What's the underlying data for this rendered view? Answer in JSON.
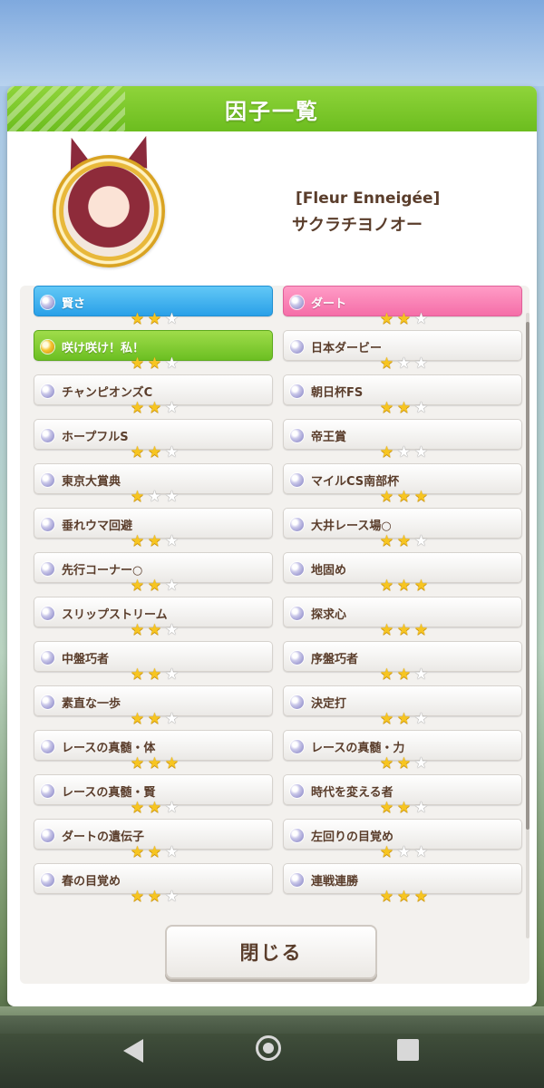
{
  "header": {
    "title": "因子一覧"
  },
  "character": {
    "title": "[Fleur Enneigée]",
    "name": "サクラチヨノオー"
  },
  "factors": {
    "left": [
      {
        "name": "賢さ",
        "stars": 2,
        "type": "blue"
      },
      {
        "name": "咲け咲け！私！",
        "stars": 2,
        "type": "green"
      },
      {
        "name": "チャンピオンズC",
        "stars": 2,
        "type": "normal"
      },
      {
        "name": "ホープフルS",
        "stars": 2,
        "type": "normal"
      },
      {
        "name": "東京大賞典",
        "stars": 1,
        "type": "normal"
      },
      {
        "name": "垂れウマ回避",
        "stars": 2,
        "type": "normal"
      },
      {
        "name": "先行コーナー○",
        "stars": 2,
        "type": "normal"
      },
      {
        "name": "スリップストリーム",
        "stars": 2,
        "type": "normal"
      },
      {
        "name": "中盤巧者",
        "stars": 2,
        "type": "normal"
      },
      {
        "name": "素直な一歩",
        "stars": 2,
        "type": "normal"
      },
      {
        "name": "レースの真髄・体",
        "stars": 3,
        "type": "normal"
      },
      {
        "name": "レースの真髄・賢",
        "stars": 2,
        "type": "normal"
      },
      {
        "name": "ダートの遺伝子",
        "stars": 2,
        "type": "normal"
      },
      {
        "name": "春の目覚め",
        "stars": 2,
        "type": "normal"
      }
    ],
    "right": [
      {
        "name": "ダート",
        "stars": 2,
        "type": "pink"
      },
      {
        "name": "日本ダービー",
        "stars": 1,
        "type": "normal"
      },
      {
        "name": "朝日杯FS",
        "stars": 2,
        "type": "normal"
      },
      {
        "name": "帝王賞",
        "stars": 1,
        "type": "normal"
      },
      {
        "name": "マイルCS南部杯",
        "stars": 3,
        "type": "normal"
      },
      {
        "name": "大井レース場○",
        "stars": 2,
        "type": "normal"
      },
      {
        "name": "地固め",
        "stars": 3,
        "type": "normal"
      },
      {
        "name": "探求心",
        "stars": 3,
        "type": "normal"
      },
      {
        "name": "序盤巧者",
        "stars": 2,
        "type": "normal"
      },
      {
        "name": "決定打",
        "stars": 2,
        "type": "normal"
      },
      {
        "name": "レースの真髄・力",
        "stars": 2,
        "type": "normal"
      },
      {
        "name": "時代を変える者",
        "stars": 2,
        "type": "normal"
      },
      {
        "name": "左回りの目覚め",
        "stars": 1,
        "type": "normal"
      },
      {
        "name": "連戦連勝",
        "stars": 3,
        "type": "normal"
      }
    ]
  },
  "close_button": {
    "label": "閉じる"
  },
  "icons": {
    "factor_orb": "orb-icon",
    "star": "star-icon",
    "nav_back": "back-icon",
    "nav_home": "home-icon",
    "nav_recent": "recent-apps-icon"
  },
  "colors": {
    "header_green": "#7cc92c",
    "blue_factor": "#2aa0e8",
    "pink_factor": "#f56ea8",
    "green_factor": "#6cbf22",
    "star_gold": "#f7c520",
    "text_brown": "#5a3d2b"
  }
}
